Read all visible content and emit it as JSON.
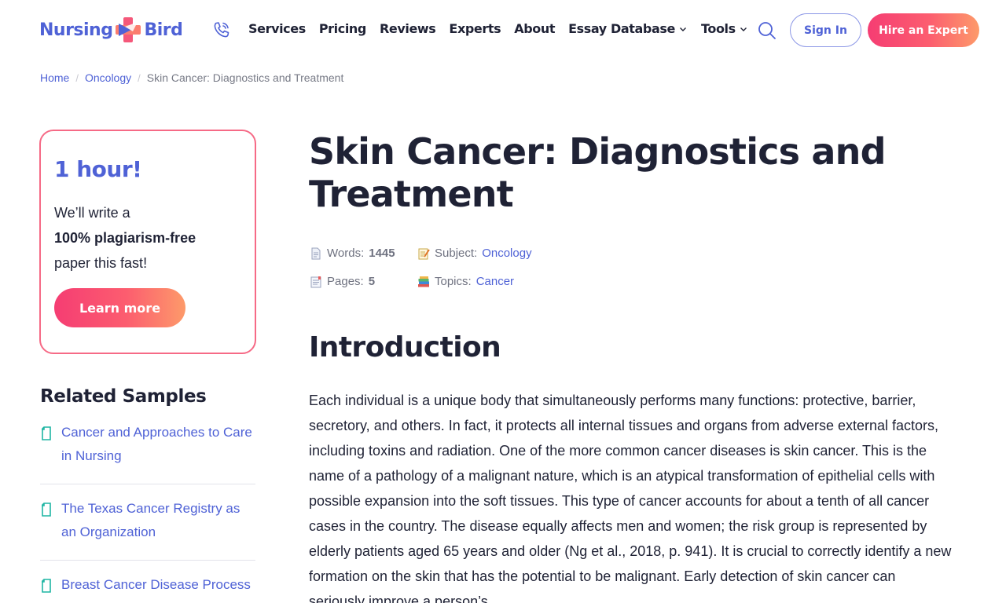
{
  "header": {
    "logo_left": "Nursing",
    "logo_right": "Bird",
    "nav": [
      "Services",
      "Pricing",
      "Reviews",
      "Experts",
      "About"
    ],
    "nav_dropdowns": [
      "Essay Database",
      "Tools"
    ],
    "signin_label": "Sign In",
    "hire_label": "Hire an Expert"
  },
  "breadcrumb": {
    "home": "Home",
    "category": "Oncology",
    "current": "Skin Cancer: Diagnostics and Treatment",
    "separator": "/"
  },
  "promo": {
    "title": "1 hour!",
    "line1": "We’ll write a",
    "line2": "100% plagiarism-free",
    "line3": "paper this fast!",
    "button": "Learn more"
  },
  "related": {
    "title": "Related Samples",
    "items": [
      "Cancer and Approaches to Care in Nursing",
      "The Texas Cancer Registry as an Organization",
      "Breast Cancer Disease Process"
    ]
  },
  "article": {
    "title": "Skin Cancer: Diagnostics and Treatment",
    "meta": {
      "words_label": "Words:",
      "words": "1445",
      "pages_label": "Pages:",
      "pages": "5",
      "subject_label": "Subject:",
      "subject": "Oncology",
      "topics_label": "Topics:",
      "topics": "Cancer"
    },
    "section_heading": "Introduction",
    "paragraph": "Each individual is a unique body that simultaneously performs many functions: protective, barrier, secretory, and others. In fact, it protects all internal tissues and organs from adverse external factors, including toxins and radiation. One of the more common cancer diseases is skin cancer. This is the name of a pathology of a malignant nature, which is an atypical transformation of epithelial cells with possible expansion into the soft tissues. This type of cancer accounts for about a tenth of all cancer cases in the country. The disease equally affects men and women; the risk group is represented by elderly patients aged 65 years and older (Ng et al., 2018, p. 941). It is crucial to correctly identify a new formation on the skin that has the potential to be malignant. Early detection of skin cancer can seriously improve a person’s"
  },
  "colors": {
    "brand_blue": "#4f62d6",
    "accent_pink": "#f53d73",
    "accent_orange": "#fd9a6a",
    "text_dark": "#1f2235",
    "teal_icon": "#1fb5a3"
  }
}
